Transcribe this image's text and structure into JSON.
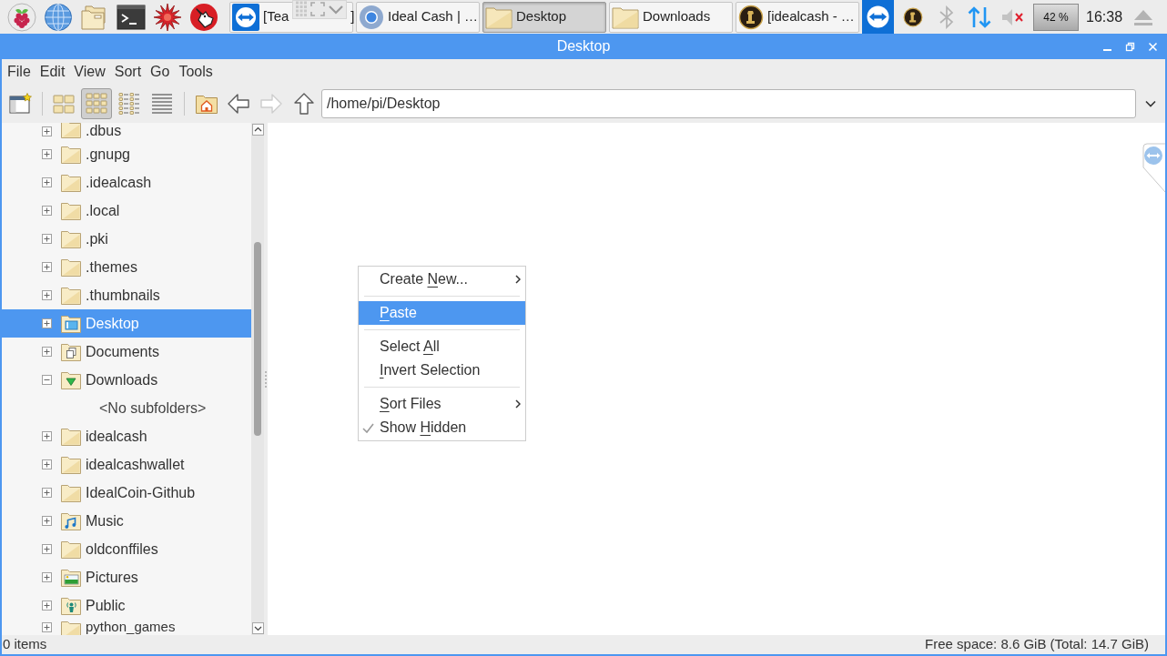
{
  "taskbar": {
    "launchers": [
      {
        "kind": "raspberry"
      },
      {
        "kind": "globe"
      },
      {
        "kind": "folders"
      },
      {
        "kind": "terminal"
      },
      {
        "kind": "starburst"
      },
      {
        "kind": "wolf"
      }
    ],
    "tasks": [
      {
        "kind": "remote",
        "label": "[Tea",
        "label_tail": "]",
        "selected": false
      },
      {
        "kind": "browser",
        "label": "Ideal Cash | …",
        "selected": false
      },
      {
        "kind": "folder",
        "label": "Desktop",
        "selected": true
      },
      {
        "kind": "folder",
        "label": "Downloads",
        "selected": false
      },
      {
        "kind": "coin",
        "label": "[idealcash - …",
        "selected": false
      }
    ],
    "tray": [
      {
        "kind": "remote"
      },
      {
        "kind": "coin"
      },
      {
        "kind": "bluetooth"
      },
      {
        "kind": "network"
      },
      {
        "kind": "volume",
        "muted": true
      }
    ],
    "cpu": "42 %",
    "clock": "16:38"
  },
  "window": {
    "title": "Desktop"
  },
  "menu_bar": [
    "File",
    "Edit",
    "View",
    "Sort",
    "Go",
    "Tools"
  ],
  "toolbar": {
    "view_modes": [
      {
        "kind": "icons",
        "selected": false
      },
      {
        "kind": "thumbnails",
        "selected": true
      },
      {
        "kind": "compact",
        "selected": false
      },
      {
        "kind": "list",
        "selected": false
      }
    ],
    "navigation": [
      {
        "kind": "back",
        "disabled": false
      },
      {
        "kind": "forward",
        "disabled": true
      },
      {
        "kind": "up",
        "disabled": false
      }
    ],
    "path": "/home/pi/Desktop"
  },
  "sidebar": {
    "tree": [
      {
        "kind": "folder",
        "label": ".dbus",
        "expanded": false,
        "selected": false
      },
      {
        "kind": "folder",
        "label": ".gnupg",
        "expanded": false,
        "selected": false
      },
      {
        "kind": "folder",
        "label": ".idealcash",
        "expanded": false,
        "selected": false
      },
      {
        "kind": "folder",
        "label": ".local",
        "expanded": false,
        "selected": false
      },
      {
        "kind": "folder",
        "label": ".pki",
        "expanded": false,
        "selected": false
      },
      {
        "kind": "folder",
        "label": ".themes",
        "expanded": false,
        "selected": false
      },
      {
        "kind": "folder",
        "label": ".thumbnails",
        "expanded": false,
        "selected": false
      },
      {
        "kind": "desktop",
        "label": "Desktop",
        "expanded": false,
        "selected": true
      },
      {
        "kind": "documents",
        "label": "Documents",
        "expanded": false,
        "selected": false
      },
      {
        "kind": "downloads",
        "label": "Downloads",
        "expanded": true,
        "selected": false,
        "children": [
          {
            "kind": "placeholder",
            "label": "<No subfolders>"
          }
        ]
      },
      {
        "kind": "folder",
        "label": "idealcash",
        "expanded": false,
        "selected": false
      },
      {
        "kind": "folder",
        "label": "idealcashwallet",
        "expanded": false,
        "selected": false
      },
      {
        "kind": "folder",
        "label": "IdealCoin-Github",
        "expanded": false,
        "selected": false
      },
      {
        "kind": "music",
        "label": "Music",
        "expanded": false,
        "selected": false
      },
      {
        "kind": "folder",
        "label": "oldconffiles",
        "expanded": false,
        "selected": false
      },
      {
        "kind": "pictures",
        "label": "Pictures",
        "expanded": false,
        "selected": false
      },
      {
        "kind": "public",
        "label": "Public",
        "expanded": false,
        "selected": false
      },
      {
        "kind": "folder",
        "label": "python_games",
        "expanded": false,
        "selected": false
      }
    ]
  },
  "context_menu": {
    "groups": [
      [
        {
          "before": "Create ",
          "accel": "N",
          "after": "ew...",
          "selected": false,
          "checked": false,
          "submenu": true
        }
      ],
      [
        {
          "accel": "P",
          "after": "aste",
          "selected": true,
          "checked": false,
          "submenu": false
        }
      ],
      [
        {
          "before": "Select ",
          "accel": "A",
          "after": "ll",
          "selected": false,
          "checked": false,
          "submenu": false
        },
        {
          "accel": "I",
          "after": "nvert Selection",
          "selected": false,
          "checked": false,
          "submenu": false
        }
      ],
      [
        {
          "accel": "S",
          "after": "ort Files",
          "selected": false,
          "checked": false,
          "submenu": true
        },
        {
          "before": "Show ",
          "accel": "H",
          "after": "idden",
          "selected": false,
          "checked": true,
          "submenu": false
        }
      ]
    ]
  },
  "status_bar": {
    "left": "0 items",
    "right": "Free space: 8.6 GiB (Total: 14.7 GiB)"
  }
}
